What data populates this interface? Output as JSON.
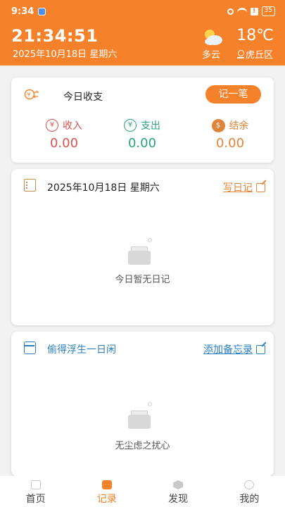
{
  "status_bar": {
    "time": "9:34",
    "battery": "35"
  },
  "header": {
    "clock": "21:34:51",
    "date": "2025年10月18日",
    "weekday": "星期六",
    "temperature": "18℃",
    "weather": "多云",
    "location": "虎丘区"
  },
  "finance_card": {
    "title": "今日收支",
    "record_button": "记一笔",
    "income": {
      "label": "收入",
      "value": "0.00",
      "color": "#d9534f"
    },
    "expense": {
      "label": "支出",
      "value": "0.00",
      "color": "#2aa37f"
    },
    "balance": {
      "label": "结余",
      "value": "0.00",
      "color": "#e0843a"
    }
  },
  "diary_card": {
    "date": "2025年10月18日",
    "weekday": "星期六",
    "write_link": "写日记",
    "empty_text": "今日暂无日记"
  },
  "memo_card": {
    "title": "偷得浮生一日闲",
    "add_link": "添加备忘录",
    "empty_text": "无尘虑之扰心"
  },
  "bottom_nav": {
    "items": [
      {
        "label": "首页",
        "icon": "home-icon"
      },
      {
        "label": "记录",
        "icon": "record-icon",
        "active": true
      },
      {
        "label": "发现",
        "icon": "discover-icon"
      },
      {
        "label": "我的",
        "icon": "me-icon"
      }
    ]
  },
  "colors": {
    "accent": "#f5812a",
    "blue": "#2b7fc0"
  }
}
